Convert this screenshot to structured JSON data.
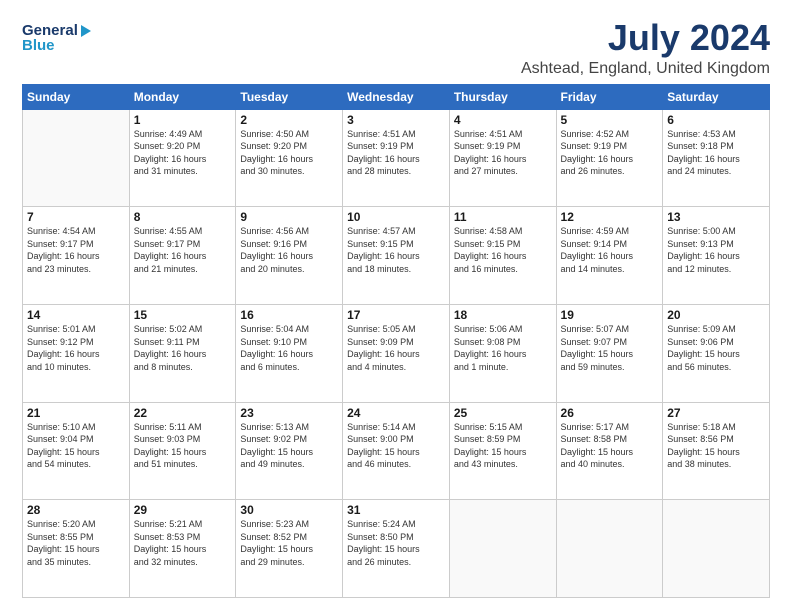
{
  "header": {
    "logo_line1": "General",
    "logo_line2": "Blue",
    "title": "July 2024",
    "subtitle": "Ashtead, England, United Kingdom"
  },
  "days_of_week": [
    "Sunday",
    "Monday",
    "Tuesday",
    "Wednesday",
    "Thursday",
    "Friday",
    "Saturday"
  ],
  "weeks": [
    [
      {
        "day": "",
        "info": ""
      },
      {
        "day": "1",
        "info": "Sunrise: 4:49 AM\nSunset: 9:20 PM\nDaylight: 16 hours\nand 31 minutes."
      },
      {
        "day": "2",
        "info": "Sunrise: 4:50 AM\nSunset: 9:20 PM\nDaylight: 16 hours\nand 30 minutes."
      },
      {
        "day": "3",
        "info": "Sunrise: 4:51 AM\nSunset: 9:19 PM\nDaylight: 16 hours\nand 28 minutes."
      },
      {
        "day": "4",
        "info": "Sunrise: 4:51 AM\nSunset: 9:19 PM\nDaylight: 16 hours\nand 27 minutes."
      },
      {
        "day": "5",
        "info": "Sunrise: 4:52 AM\nSunset: 9:19 PM\nDaylight: 16 hours\nand 26 minutes."
      },
      {
        "day": "6",
        "info": "Sunrise: 4:53 AM\nSunset: 9:18 PM\nDaylight: 16 hours\nand 24 minutes."
      }
    ],
    [
      {
        "day": "7",
        "info": "Sunrise: 4:54 AM\nSunset: 9:17 PM\nDaylight: 16 hours\nand 23 minutes."
      },
      {
        "day": "8",
        "info": "Sunrise: 4:55 AM\nSunset: 9:17 PM\nDaylight: 16 hours\nand 21 minutes."
      },
      {
        "day": "9",
        "info": "Sunrise: 4:56 AM\nSunset: 9:16 PM\nDaylight: 16 hours\nand 20 minutes."
      },
      {
        "day": "10",
        "info": "Sunrise: 4:57 AM\nSunset: 9:15 PM\nDaylight: 16 hours\nand 18 minutes."
      },
      {
        "day": "11",
        "info": "Sunrise: 4:58 AM\nSunset: 9:15 PM\nDaylight: 16 hours\nand 16 minutes."
      },
      {
        "day": "12",
        "info": "Sunrise: 4:59 AM\nSunset: 9:14 PM\nDaylight: 16 hours\nand 14 minutes."
      },
      {
        "day": "13",
        "info": "Sunrise: 5:00 AM\nSunset: 9:13 PM\nDaylight: 16 hours\nand 12 minutes."
      }
    ],
    [
      {
        "day": "14",
        "info": "Sunrise: 5:01 AM\nSunset: 9:12 PM\nDaylight: 16 hours\nand 10 minutes."
      },
      {
        "day": "15",
        "info": "Sunrise: 5:02 AM\nSunset: 9:11 PM\nDaylight: 16 hours\nand 8 minutes."
      },
      {
        "day": "16",
        "info": "Sunrise: 5:04 AM\nSunset: 9:10 PM\nDaylight: 16 hours\nand 6 minutes."
      },
      {
        "day": "17",
        "info": "Sunrise: 5:05 AM\nSunset: 9:09 PM\nDaylight: 16 hours\nand 4 minutes."
      },
      {
        "day": "18",
        "info": "Sunrise: 5:06 AM\nSunset: 9:08 PM\nDaylight: 16 hours\nand 1 minute."
      },
      {
        "day": "19",
        "info": "Sunrise: 5:07 AM\nSunset: 9:07 PM\nDaylight: 15 hours\nand 59 minutes."
      },
      {
        "day": "20",
        "info": "Sunrise: 5:09 AM\nSunset: 9:06 PM\nDaylight: 15 hours\nand 56 minutes."
      }
    ],
    [
      {
        "day": "21",
        "info": "Sunrise: 5:10 AM\nSunset: 9:04 PM\nDaylight: 15 hours\nand 54 minutes."
      },
      {
        "day": "22",
        "info": "Sunrise: 5:11 AM\nSunset: 9:03 PM\nDaylight: 15 hours\nand 51 minutes."
      },
      {
        "day": "23",
        "info": "Sunrise: 5:13 AM\nSunset: 9:02 PM\nDaylight: 15 hours\nand 49 minutes."
      },
      {
        "day": "24",
        "info": "Sunrise: 5:14 AM\nSunset: 9:00 PM\nDaylight: 15 hours\nand 46 minutes."
      },
      {
        "day": "25",
        "info": "Sunrise: 5:15 AM\nSunset: 8:59 PM\nDaylight: 15 hours\nand 43 minutes."
      },
      {
        "day": "26",
        "info": "Sunrise: 5:17 AM\nSunset: 8:58 PM\nDaylight: 15 hours\nand 40 minutes."
      },
      {
        "day": "27",
        "info": "Sunrise: 5:18 AM\nSunset: 8:56 PM\nDaylight: 15 hours\nand 38 minutes."
      }
    ],
    [
      {
        "day": "28",
        "info": "Sunrise: 5:20 AM\nSunset: 8:55 PM\nDaylight: 15 hours\nand 35 minutes."
      },
      {
        "day": "29",
        "info": "Sunrise: 5:21 AM\nSunset: 8:53 PM\nDaylight: 15 hours\nand 32 minutes."
      },
      {
        "day": "30",
        "info": "Sunrise: 5:23 AM\nSunset: 8:52 PM\nDaylight: 15 hours\nand 29 minutes."
      },
      {
        "day": "31",
        "info": "Sunrise: 5:24 AM\nSunset: 8:50 PM\nDaylight: 15 hours\nand 26 minutes."
      },
      {
        "day": "",
        "info": ""
      },
      {
        "day": "",
        "info": ""
      },
      {
        "day": "",
        "info": ""
      }
    ]
  ]
}
